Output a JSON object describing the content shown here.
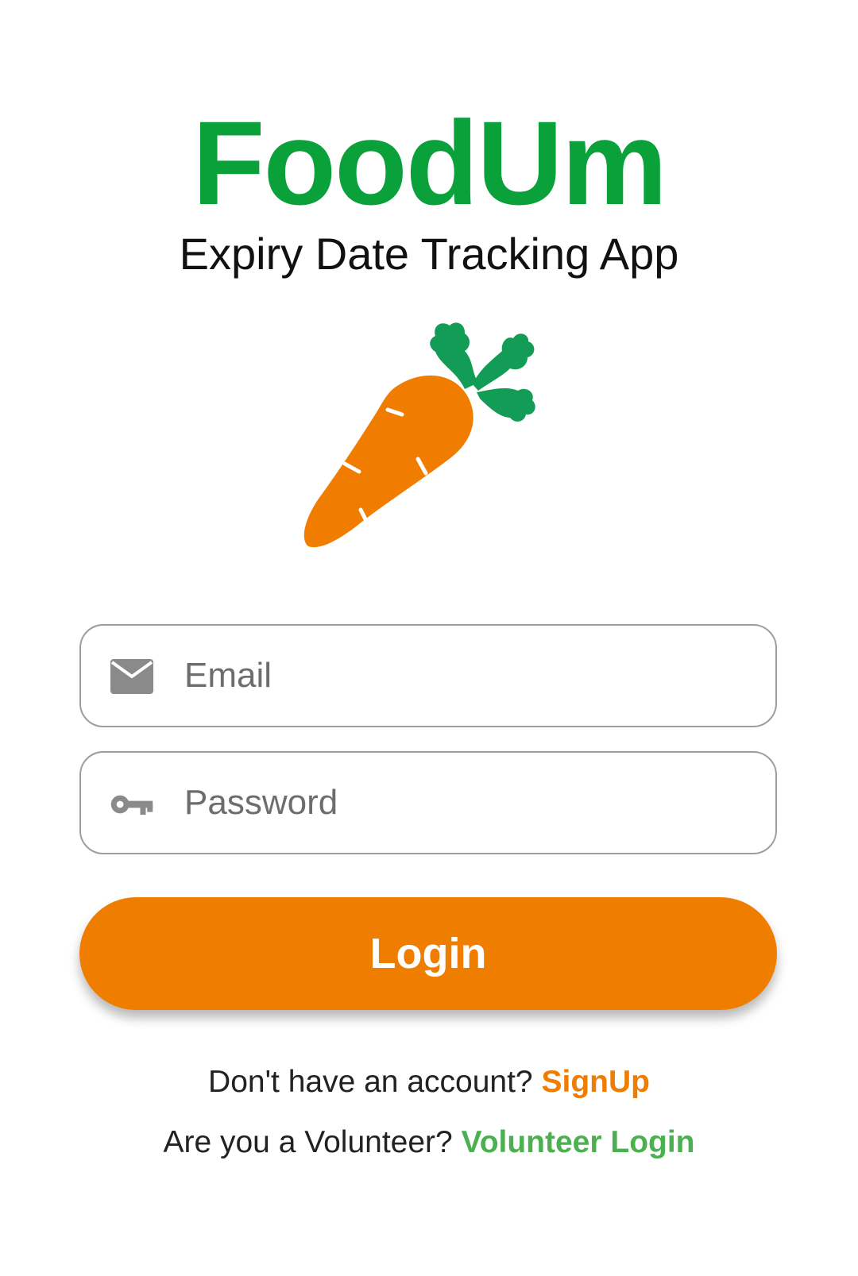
{
  "app": {
    "title": "FoodUm",
    "subtitle": "Expiry Date Tracking App",
    "logo_icon": "carrot-icon"
  },
  "form": {
    "email": {
      "placeholder": "Email",
      "value": "",
      "icon": "mail-icon"
    },
    "password": {
      "placeholder": "Password",
      "value": "",
      "icon": "key-icon"
    },
    "login_label": "Login"
  },
  "footer": {
    "signup_prompt": "Don't have an account?",
    "signup_link": "SignUp",
    "volunteer_prompt": "Are you a Volunteer?",
    "volunteer_link": "Volunteer Login"
  },
  "colors": {
    "brand_green": "#0aa03a",
    "accent_orange": "#ef7d00",
    "volunteer_green": "#4caf50",
    "leaf_green": "#129c55",
    "field_border": "#9e9e9e"
  }
}
